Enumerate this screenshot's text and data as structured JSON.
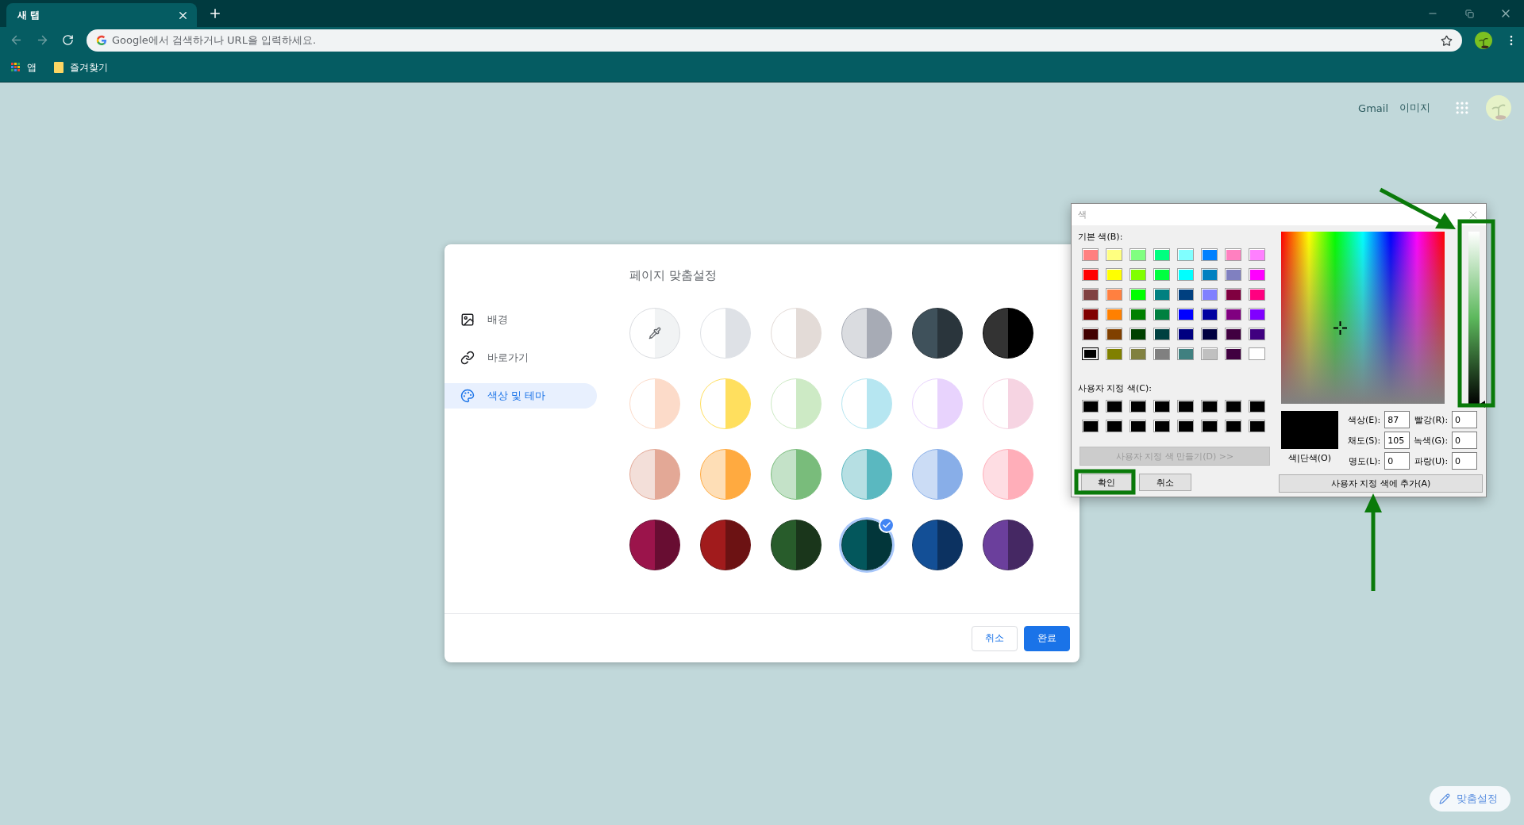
{
  "browser": {
    "tab": {
      "title": "새 탭"
    },
    "omnibox": {
      "placeholder": "Google에서 검색하거나 URL을 입력하세요."
    },
    "bookmarks": [
      {
        "label": "앱",
        "kind": "apps"
      },
      {
        "label": "즐겨찾기",
        "kind": "folder"
      }
    ]
  },
  "page": {
    "links": [
      "Gmail",
      "이미지"
    ],
    "customize_button": "맞춤설정"
  },
  "customize_dialog": {
    "title": "페이지 맞춤설정",
    "nav": [
      {
        "label": "배경",
        "kind": "background",
        "selected": false
      },
      {
        "label": "바로가기",
        "kind": "shortcuts",
        "selected": false
      },
      {
        "label": "색상 및 테마",
        "kind": "theme",
        "selected": true
      }
    ],
    "themes": [
      {
        "kind": "custom",
        "halves": [
          {
            "color": "#ffffff"
          },
          {
            "color": "#f1f3f4"
          }
        ],
        "selected": false
      },
      {
        "kind": "preset",
        "halves": [
          {
            "color": "#ffffff"
          },
          {
            "color": "#dee1e6"
          }
        ],
        "selected": false
      },
      {
        "kind": "preset",
        "halves": [
          {
            "color": "#ffffff"
          },
          {
            "color": "#e3dbd7"
          }
        ],
        "selected": false
      },
      {
        "kind": "preset",
        "halves": [
          {
            "color": "#dadce0"
          },
          {
            "color": "#a7abb5"
          }
        ],
        "selected": false
      },
      {
        "kind": "preset",
        "halves": [
          {
            "color": "#3f515b"
          },
          {
            "color": "#2a353c"
          }
        ],
        "selected": false
      },
      {
        "kind": "preset",
        "halves": [
          {
            "color": "#333333"
          },
          {
            "color": "#000000"
          }
        ],
        "selected": false
      },
      {
        "kind": "preset",
        "halves": [
          {
            "color": "#ffffff"
          },
          {
            "color": "#fcdbc9"
          }
        ],
        "selected": false
      },
      {
        "kind": "preset",
        "halves": [
          {
            "color": "#ffffff"
          },
          {
            "color": "#ffdf5e"
          }
        ],
        "selected": false
      },
      {
        "kind": "preset",
        "halves": [
          {
            "color": "#ffffff"
          },
          {
            "color": "#cdeac5"
          }
        ],
        "selected": false
      },
      {
        "kind": "preset",
        "halves": [
          {
            "color": "#ffffff"
          },
          {
            "color": "#b6e6f1"
          }
        ],
        "selected": false
      },
      {
        "kind": "preset",
        "halves": [
          {
            "color": "#ffffff"
          },
          {
            "color": "#e8d3fd"
          }
        ],
        "selected": false
      },
      {
        "kind": "preset",
        "halves": [
          {
            "color": "#ffffff"
          },
          {
            "color": "#f6d4e2"
          }
        ],
        "selected": false
      },
      {
        "kind": "preset",
        "halves": [
          {
            "color": "#f3dfd9"
          },
          {
            "color": "#e3a896"
          }
        ],
        "selected": false
      },
      {
        "kind": "preset",
        "halves": [
          {
            "color": "#fedeb6"
          },
          {
            "color": "#ffaa40"
          }
        ],
        "selected": false
      },
      {
        "kind": "preset",
        "halves": [
          {
            "color": "#c4e2c8"
          },
          {
            "color": "#79bc7b"
          }
        ],
        "selected": false
      },
      {
        "kind": "preset",
        "halves": [
          {
            "color": "#b6dfe3"
          },
          {
            "color": "#5ab8c0"
          }
        ],
        "selected": false
      },
      {
        "kind": "preset",
        "halves": [
          {
            "color": "#cbdcf5"
          },
          {
            "color": "#88aee8"
          }
        ],
        "selected": false
      },
      {
        "kind": "preset",
        "halves": [
          {
            "color": "#fedde3"
          },
          {
            "color": "#ffaeb9"
          }
        ],
        "selected": false
      },
      {
        "kind": "preset",
        "halves": [
          {
            "color": "#9b144b"
          },
          {
            "color": "#680d32"
          }
        ],
        "selected": false
      },
      {
        "kind": "preset",
        "halves": [
          {
            "color": "#a11b1c"
          },
          {
            "color": "#6c1213"
          }
        ],
        "selected": false
      },
      {
        "kind": "preset",
        "halves": [
          {
            "color": "#285c2b"
          },
          {
            "color": "#1a361b"
          }
        ],
        "selected": false
      },
      {
        "kind": "preset",
        "halves": [
          {
            "color": "#03575c"
          },
          {
            "color": "#02363a"
          }
        ],
        "selected": true
      },
      {
        "kind": "preset",
        "halves": [
          {
            "color": "#134f96"
          },
          {
            "color": "#0c3261"
          }
        ],
        "selected": false
      },
      {
        "kind": "preset",
        "halves": [
          {
            "color": "#6b3f9c"
          },
          {
            "color": "#452863"
          }
        ],
        "selected": false
      }
    ],
    "buttons": [
      {
        "label": "취소",
        "kind": "secondary"
      },
      {
        "label": "완료",
        "kind": "primary"
      }
    ]
  },
  "color_dialog": {
    "title": "색",
    "basic_label": "기본 색(B):",
    "basic_colors": [
      {
        "color": "#ff8080",
        "selected": false
      },
      {
        "color": "#ffff80",
        "selected": false
      },
      {
        "color": "#80ff80",
        "selected": false
      },
      {
        "color": "#00ff80",
        "selected": false
      },
      {
        "color": "#80ffff",
        "selected": false
      },
      {
        "color": "#0080ff",
        "selected": false
      },
      {
        "color": "#ff80c0",
        "selected": false
      },
      {
        "color": "#ff80ff",
        "selected": false
      },
      {
        "color": "#ff0000",
        "selected": false
      },
      {
        "color": "#ffff00",
        "selected": false
      },
      {
        "color": "#80ff00",
        "selected": false
      },
      {
        "color": "#00ff40",
        "selected": false
      },
      {
        "color": "#00ffff",
        "selected": false
      },
      {
        "color": "#0080c0",
        "selected": false
      },
      {
        "color": "#8080c0",
        "selected": false
      },
      {
        "color": "#ff00ff",
        "selected": false
      },
      {
        "color": "#804040",
        "selected": false
      },
      {
        "color": "#ff8040",
        "selected": false
      },
      {
        "color": "#00ff00",
        "selected": false
      },
      {
        "color": "#008080",
        "selected": false
      },
      {
        "color": "#004080",
        "selected": false
      },
      {
        "color": "#8080ff",
        "selected": false
      },
      {
        "color": "#800040",
        "selected": false
      },
      {
        "color": "#ff0080",
        "selected": false
      },
      {
        "color": "#800000",
        "selected": false
      },
      {
        "color": "#ff8000",
        "selected": false
      },
      {
        "color": "#008000",
        "selected": false
      },
      {
        "color": "#008040",
        "selected": false
      },
      {
        "color": "#0000ff",
        "selected": false
      },
      {
        "color": "#0000a0",
        "selected": false
      },
      {
        "color": "#800080",
        "selected": false
      },
      {
        "color": "#8000ff",
        "selected": false
      },
      {
        "color": "#400000",
        "selected": false
      },
      {
        "color": "#804000",
        "selected": false
      },
      {
        "color": "#004000",
        "selected": false
      },
      {
        "color": "#004040",
        "selected": false
      },
      {
        "color": "#000080",
        "selected": false
      },
      {
        "color": "#000040",
        "selected": false
      },
      {
        "color": "#400040",
        "selected": false
      },
      {
        "color": "#400080",
        "selected": false
      },
      {
        "color": "#000000",
        "selected": true
      },
      {
        "color": "#808000",
        "selected": false
      },
      {
        "color": "#808040",
        "selected": false
      },
      {
        "color": "#808080",
        "selected": false
      },
      {
        "color": "#408080",
        "selected": false
      },
      {
        "color": "#c0c0c0",
        "selected": false
      },
      {
        "color": "#400040",
        "selected": false
      },
      {
        "color": "#ffffff",
        "selected": false
      }
    ],
    "custom_label": "사용자 지정 색(C):",
    "custom_colors": [
      {
        "color": "#000000"
      },
      {
        "color": "#000000"
      },
      {
        "color": "#000000"
      },
      {
        "color": "#000000"
      },
      {
        "color": "#000000"
      },
      {
        "color": "#000000"
      },
      {
        "color": "#000000"
      },
      {
        "color": "#000000"
      },
      {
        "color": "#000000"
      },
      {
        "color": "#000000"
      },
      {
        "color": "#000000"
      },
      {
        "color": "#000000"
      },
      {
        "color": "#000000"
      },
      {
        "color": "#000000"
      },
      {
        "color": "#000000"
      },
      {
        "color": "#000000"
      }
    ],
    "define_button": {
      "label": "사용자 지정 색 만들기(D) >>",
      "disabled": true
    },
    "ok_button": "확인",
    "cancel_button": "취소",
    "luminance": {
      "level": 0
    },
    "preview": {
      "color": "#000000",
      "label": "색|단색(O)"
    },
    "fields": [
      {
        "label": "색상(E):",
        "value": "87"
      },
      {
        "label": "빨강(R):",
        "value": "0"
      },
      {
        "label": "채도(S):",
        "value": "105"
      },
      {
        "label": "녹색(G):",
        "value": "0"
      },
      {
        "label": "명도(L):",
        "value": "0"
      },
      {
        "label": "파랑(U):",
        "value": "0"
      }
    ],
    "add_button": "사용자 지정 색에 추가(A)"
  }
}
